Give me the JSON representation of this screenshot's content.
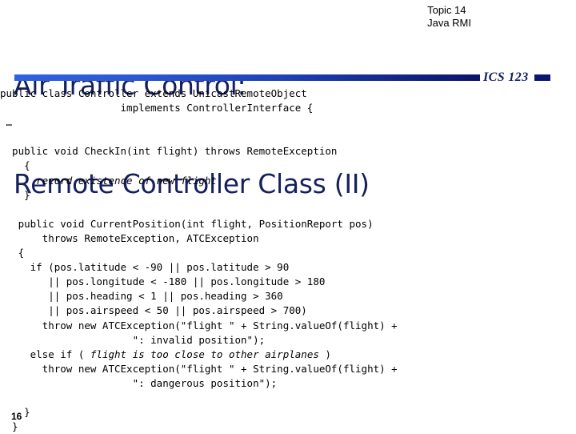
{
  "slide": {
    "title_lines": [
      "Air Traffic Control:",
      "Remote Controller Class (II)"
    ],
    "topic": {
      "number": "Topic 14",
      "subject": "Java RMI"
    },
    "course_label": "ICS 123",
    "page_number": "16",
    "colors": {
      "title": "#15205c",
      "rule_start": "#2f62dd",
      "rule_end": "#0a1566",
      "course_label": "#11205e",
      "code_text": "#000000",
      "background": "#ffffff"
    }
  },
  "code": {
    "language": "java",
    "lines": [
      {
        "text": "public class Controller extends UnicastRemoteObject",
        "italic": false
      },
      {
        "text": "                    implements ControllerInterface {",
        "italic": false
      },
      {
        "text": " …",
        "italic": false
      },
      {
        "text": "",
        "italic": false
      },
      {
        "text": "  public void CheckIn(int flight) throws RemoteException",
        "italic": false
      },
      {
        "text": "    {",
        "italic": false
      },
      {
        "text": "      record existence of new flight",
        "italic": true
      },
      {
        "text": "    }",
        "italic": false
      },
      {
        "text": "",
        "italic": false
      },
      {
        "text": "   public void CurrentPosition(int flight, PositionReport pos)",
        "italic": false
      },
      {
        "text": "       throws RemoteException, ATCException",
        "italic": false
      },
      {
        "text": "   {",
        "italic": false
      },
      {
        "text": "     if (pos.latitude < -90 || pos.latitude > 90",
        "italic": false
      },
      {
        "text": "        || pos.longitude < -180 || pos.longitude > 180",
        "italic": false
      },
      {
        "text": "        || pos.heading < 1 || pos.heading > 360",
        "italic": false
      },
      {
        "text": "        || pos.airspeed < 50 || pos.airspeed > 700)",
        "italic": false
      },
      {
        "text": "       throw new ATCException(\"flight \" + String.valueOf(flight) +",
        "italic": false
      },
      {
        "text": "                      \": invalid position\");",
        "italic": false
      },
      {
        "text": "     else if ( flight is too close to other airplanes )",
        "italic": false
      },
      {
        "text": "       throw new ATCException(\"flight \" + String.valueOf(flight) +",
        "italic": false
      },
      {
        "text": "                      \": dangerous position\");",
        "italic": false
      },
      {
        "text": "",
        "italic": false
      },
      {
        "text": "    }",
        "italic": false
      },
      {
        "text": "  }",
        "italic": false
      }
    ],
    "italic_fragments": [
      "record existence of new flight",
      "flight is too close to other airplanes"
    ]
  }
}
